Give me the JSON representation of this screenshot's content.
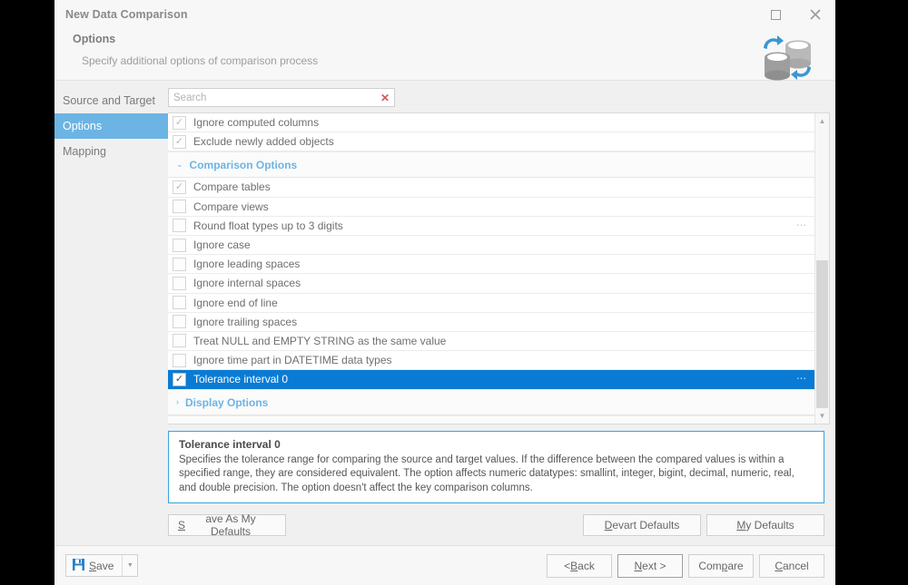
{
  "window": {
    "title": "New Data Comparison",
    "maximize_icon": "maximize-icon",
    "close_icon": "close-icon"
  },
  "header": {
    "title": "Options",
    "subtitle": "Specify additional options of comparison process",
    "logo_icon": "database-sync-icon"
  },
  "sidebar": {
    "items": [
      {
        "label": "Source and Target",
        "active": false
      },
      {
        "label": "Options",
        "active": true
      },
      {
        "label": "Mapping",
        "active": false
      }
    ]
  },
  "search": {
    "value": "",
    "placeholder": "Search",
    "clear_icon": "clear-icon",
    "clear_glyph": "✕"
  },
  "options_list": {
    "top_items": [
      {
        "label": "Ignore computed columns",
        "checked": true,
        "ellipsis": false
      },
      {
        "label": "Exclude newly added objects",
        "checked": true,
        "ellipsis": false
      }
    ],
    "groups": [
      {
        "title": "Comparison Options",
        "expanded": true,
        "chevron": "⌄",
        "items": [
          {
            "label": "Compare tables",
            "checked": true,
            "ellipsis": false,
            "selected": false
          },
          {
            "label": "Compare views",
            "checked": false,
            "ellipsis": false,
            "selected": false
          },
          {
            "label": "Round float types up to 3 digits",
            "checked": false,
            "ellipsis": true,
            "selected": false
          },
          {
            "label": "Ignore case",
            "checked": false,
            "ellipsis": false,
            "selected": false
          },
          {
            "label": "Ignore leading spaces",
            "checked": false,
            "ellipsis": false,
            "selected": false
          },
          {
            "label": "Ignore internal spaces",
            "checked": false,
            "ellipsis": false,
            "selected": false
          },
          {
            "label": "Ignore end of line",
            "checked": false,
            "ellipsis": false,
            "selected": false
          },
          {
            "label": "Ignore trailing spaces",
            "checked": false,
            "ellipsis": false,
            "selected": false
          },
          {
            "label": "Treat NULL and EMPTY STRING as the same value",
            "checked": false,
            "ellipsis": false,
            "selected": false
          },
          {
            "label": "Ignore time part in DATETIME data types",
            "checked": false,
            "ellipsis": false,
            "selected": false
          },
          {
            "label": "Tolerance interval 0",
            "checked": true,
            "ellipsis": true,
            "selected": true
          }
        ]
      },
      {
        "title": "Display Options",
        "expanded": false,
        "chevron": "›",
        "items": []
      }
    ],
    "checkmark_glyph": "✓",
    "ellipsis_glyph": "⋯"
  },
  "scrollbar": {
    "up_glyph": "▲",
    "down_glyph": "▼"
  },
  "description": {
    "title": "Tolerance interval 0",
    "text": "Specifies the tolerance range for comparing the source and target values. If the difference between the compared values is within a specified range, they are considered equivalent. The option affects numeric datatypes: smallint, integer, bigint, decimal, numeric, real, and double precision. The option doesn't affect the key comparison columns."
  },
  "defaults_buttons": {
    "save_as_my_defaults": {
      "pre": "",
      "accel": "S",
      "post": "ave As My Defaults"
    },
    "devart_defaults": {
      "pre": "",
      "accel": "D",
      "post": "evart Defaults"
    },
    "my_defaults": {
      "pre": "",
      "accel": "M",
      "post": "y Defaults"
    }
  },
  "footer": {
    "save": {
      "pre": "",
      "accel": "S",
      "post": "ave"
    },
    "save_icon": "save-floppy-icon",
    "dropdown_glyph": "▼",
    "back": {
      "pre": "< ",
      "accel": "B",
      "post": "ack"
    },
    "next": {
      "pre": "",
      "accel": "N",
      "post": "ext >"
    },
    "compare": {
      "pre": "Com",
      "accel": "p",
      "post": "are"
    },
    "cancel": {
      "pre": "",
      "accel": "C",
      "post": "ancel"
    }
  },
  "colors": {
    "selection_blue": "#0a7bd4",
    "sidebar_blue": "#6cb4e4",
    "group_blue": "#6cb4e4",
    "desc_border": "#3ba2e0",
    "clear_red": "#d05a5a"
  }
}
